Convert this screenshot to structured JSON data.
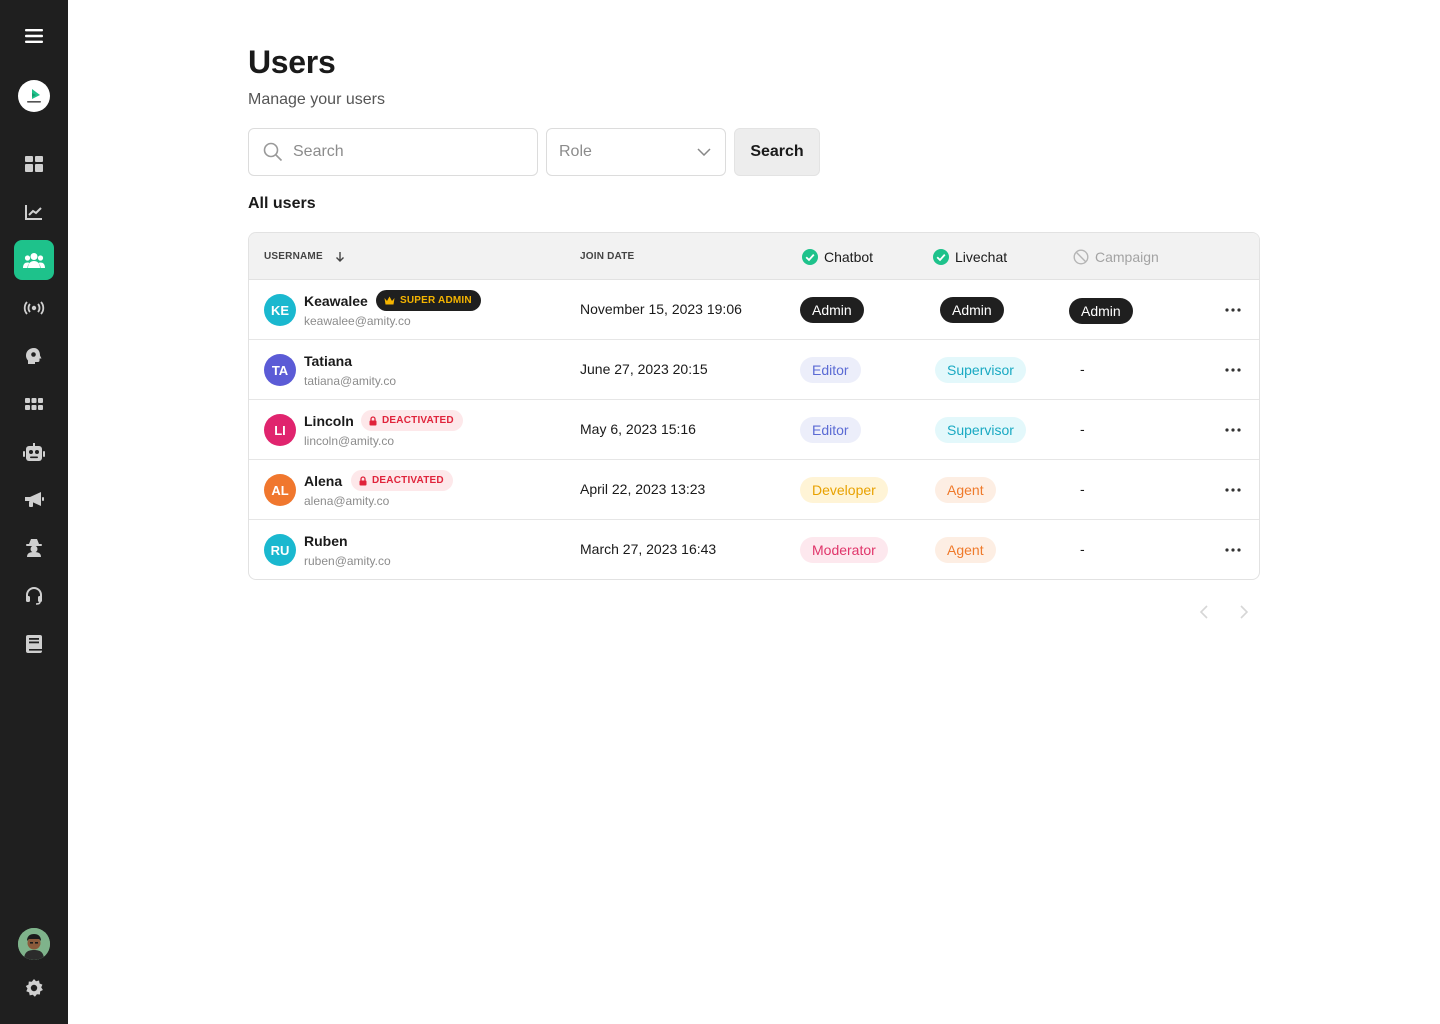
{
  "sidebar": {
    "items": [
      {
        "icon": "hamburger-menu-icon"
      },
      {
        "icon": "brand-logo"
      },
      {
        "icon": "dashboard-grid-icon"
      },
      {
        "icon": "analytics-chart-icon"
      },
      {
        "icon": "users-icon",
        "active": true
      },
      {
        "icon": "broadcast-icon"
      },
      {
        "icon": "brain-head-icon"
      },
      {
        "icon": "apps-grid-icon"
      },
      {
        "icon": "robot-icon"
      },
      {
        "icon": "megaphone-icon"
      },
      {
        "icon": "spy-agent-icon"
      },
      {
        "icon": "headset-icon"
      },
      {
        "icon": "book-icon"
      },
      {
        "icon": "user-avatar"
      },
      {
        "icon": "gear-icon"
      }
    ],
    "accent": "#1ec28b",
    "background": "#1f1f1f"
  },
  "page": {
    "title": "Users",
    "subtitle": "Manage your users"
  },
  "filters": {
    "search_placeholder": "Search",
    "role_placeholder": "Role",
    "search_button": "Search"
  },
  "table": {
    "section_title": "All users",
    "headers": {
      "username": "USERNAME",
      "join_date": "JOIN DATE",
      "chatbot": "Chatbot",
      "livechat": "Livechat",
      "campaign": "Campaign"
    },
    "rows": [
      {
        "initials": "KE",
        "avatar_color": "#1ab8cf",
        "name": "Keawalee",
        "email": "keawalee@amity.co",
        "badge": "SUPER ADMIN",
        "badge_type": "super",
        "join_date": "November 15, 2023 19:06",
        "chatbot": "Admin",
        "livechat": "Admin",
        "campaign": "Admin"
      },
      {
        "initials": "TA",
        "avatar_color": "#5b5bd6",
        "name": "Tatiana",
        "email": "tatiana@amity.co",
        "badge": "",
        "badge_type": "",
        "join_date": "June 27, 2023 20:15",
        "chatbot": "Editor",
        "livechat": "Supervisor",
        "campaign": "-"
      },
      {
        "initials": "LI",
        "avatar_color": "#e0246e",
        "name": "Lincoln",
        "email": "lincoln@amity.co",
        "badge": "DEACTIVATED",
        "badge_type": "deactivated",
        "join_date": "May 6, 2023 15:16",
        "chatbot": "Editor",
        "livechat": "Supervisor",
        "campaign": "-"
      },
      {
        "initials": "AL",
        "avatar_color": "#f0772e",
        "name": "Alena",
        "email": "alena@amity.co",
        "badge": "DEACTIVATED",
        "badge_type": "deactivated",
        "join_date": "April 22, 2023 13:23",
        "chatbot": "Developer",
        "livechat": "Agent",
        "campaign": "-"
      },
      {
        "initials": "RU",
        "avatar_color": "#1ab8cf",
        "name": "Ruben",
        "email": "ruben@amity.co",
        "badge": "",
        "badge_type": "",
        "join_date": "March 27, 2023 16:43",
        "chatbot": "Moderator",
        "livechat": "Agent",
        "campaign": "-"
      }
    ]
  }
}
